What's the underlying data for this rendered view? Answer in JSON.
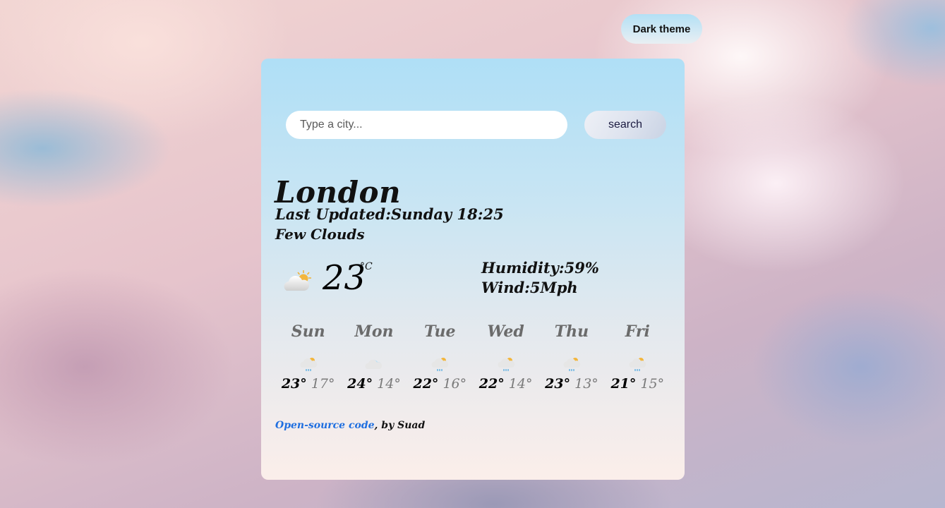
{
  "header": {
    "theme_toggle_label": "Dark theme"
  },
  "search": {
    "placeholder": "Type a city...",
    "value": "",
    "button_label": "search"
  },
  "current": {
    "city": "London",
    "last_updated": "Last Updated:Sunday 18:25",
    "description": "Few Clouds",
    "icon": "few-clouds-icon",
    "temperature": "23",
    "unit": "°C",
    "humidity": "Humidity:59%",
    "wind": "Wind:5Mph"
  },
  "forecast": [
    {
      "day": "Sun",
      "icon": "rain-sun-icon",
      "max": "23°",
      "min": "17°"
    },
    {
      "day": "Mon",
      "icon": "cloud-icon",
      "max": "24°",
      "min": "14°"
    },
    {
      "day": "Tue",
      "icon": "rain-sun-icon",
      "max": "22°",
      "min": "16°"
    },
    {
      "day": "Wed",
      "icon": "rain-sun-icon",
      "max": "22°",
      "min": "14°"
    },
    {
      "day": "Thu",
      "icon": "rain-sun-icon",
      "max": "23°",
      "min": "13°"
    },
    {
      "day": "Fri",
      "icon": "rain-sun-icon",
      "max": "21°",
      "min": "15°"
    }
  ],
  "footer": {
    "link_text": "Open-source code",
    "suffix": ", by Suad"
  },
  "colors": {
    "link": "#1f6fe0",
    "card_top": "#afdff6",
    "card_bottom": "#fbeeea"
  }
}
